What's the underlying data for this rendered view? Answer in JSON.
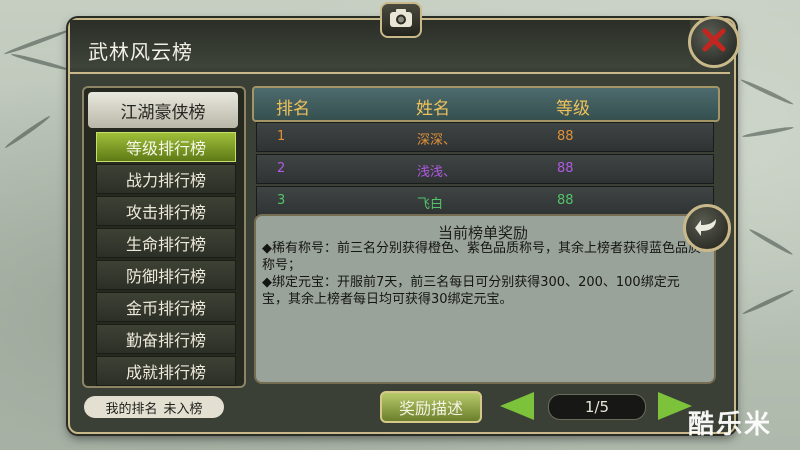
{
  "window": {
    "title": "武林风云榜"
  },
  "menu": {
    "header": "江湖豪侠榜",
    "items": [
      {
        "label": "等级排行榜",
        "active": true
      },
      {
        "label": "战力排行榜",
        "active": false
      },
      {
        "label": "攻击排行榜",
        "active": false
      },
      {
        "label": "生命排行榜",
        "active": false
      },
      {
        "label": "防御排行榜",
        "active": false
      },
      {
        "label": "金币排行榜",
        "active": false
      },
      {
        "label": "勤奋排行榜",
        "active": false
      },
      {
        "label": "成就排行榜",
        "active": false
      }
    ]
  },
  "my_rank": {
    "label": "我的排名",
    "value": "未入榜"
  },
  "table": {
    "headers": [
      "排名",
      "姓名",
      "等级"
    ],
    "rows": [
      {
        "rank": "1",
        "name": "深深、",
        "level": "88",
        "color": "#e0913a"
      },
      {
        "rank": "2",
        "name": "浅浅、",
        "level": "88",
        "color": "#b25ae3"
      },
      {
        "rank": "3",
        "name": "飞白",
        "level": "88",
        "color": "#53c46a"
      }
    ]
  },
  "reward": {
    "title": "当前榜单奖励",
    "line1": "◆稀有称号：前三名分别获得橙色、紫色品质称号，其余上榜者获得蓝色品质称号；",
    "line2": "◆绑定元宝：开服前7天，前三名每日可分别获得300、200、100绑定元宝，其余上榜者每日均可获得30绑定元宝。"
  },
  "footer": {
    "reward_button": "奖励描述",
    "page": "1/5"
  },
  "watermark": "酷乐米",
  "icons": {
    "camera": "camera-icon",
    "close": "close-icon",
    "back": "back-arrow-icon",
    "prev": "prev-arrow-icon",
    "next": "next-arrow-icon"
  }
}
